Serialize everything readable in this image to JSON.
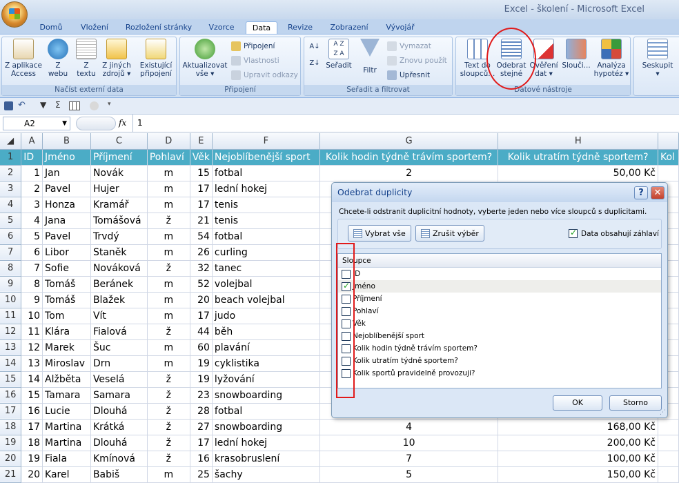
{
  "app": {
    "title": "Excel - školení - Microsoft Excel"
  },
  "tabs": [
    "Domů",
    "Vložení",
    "Rozložení stránky",
    "Vzorce",
    "Data",
    "Revize",
    "Zobrazení",
    "Vývojář"
  ],
  "ribbon": {
    "groups": {
      "external": "Načíst externí data",
      "connections": "Připojení",
      "sort": "Seřadit a filtrovat",
      "tools": "Datové nástroje"
    },
    "buttons": {
      "access": [
        "Z aplikace",
        "Access"
      ],
      "web": [
        "Z",
        "webu"
      ],
      "text": [
        "Z",
        "textu"
      ],
      "other": [
        "Z jiných",
        "zdrojů ▾"
      ],
      "existing": [
        "Existující",
        "připojení"
      ],
      "refresh": [
        "Aktualizovat",
        "vše ▾"
      ],
      "connections": "Připojení",
      "properties": "Vlastnosti",
      "editlinks": "Upravit odkazy",
      "sort": "Seřadit",
      "filter": "Filtr",
      "clear": "Vymazat",
      "reapply": "Znovu použít",
      "advanced": "Upřesnit",
      "text_to_columns": [
        "Text do",
        "sloupců..."
      ],
      "remove_duplicates": [
        "Odebrat",
        "stejné"
      ],
      "validation": [
        "Ověření",
        "dat ▾"
      ],
      "consolidate": [
        "Slouči..."
      ],
      "whatif": [
        "Analýza",
        "hypotéz ▾"
      ],
      "group": [
        "Seskupit",
        "▾"
      ]
    }
  },
  "formula": {
    "namebox": "A2",
    "fx": "fx",
    "value": "1"
  },
  "columns": [
    "A",
    "B",
    "C",
    "D",
    "E",
    "F",
    "G",
    "H"
  ],
  "headers": [
    "ID",
    "Jméno",
    "Příjmení",
    "Pohlaví",
    "Věk",
    "Nejoblíbenější sport",
    "Kolik hodin týdně trávím sportem?",
    "Kolik utratím týdně sportem?",
    "Kol"
  ],
  "rows": [
    [
      "2",
      "1",
      "Jan",
      "Novák",
      "m",
      "15",
      "fotbal",
      "2",
      "50,00 Kč"
    ],
    [
      "3",
      "2",
      "Pavel",
      "Hujer",
      "m",
      "17",
      "lední hokej",
      "",
      ""
    ],
    [
      "4",
      "3",
      "Honza",
      "Kramář",
      "m",
      "17",
      "tenis",
      "",
      ""
    ],
    [
      "5",
      "4",
      "Jana",
      "Tomášová",
      "ž",
      "21",
      "tenis",
      "",
      ""
    ],
    [
      "6",
      "5",
      "Pavel",
      "Trvdý",
      "m",
      "54",
      "fotbal",
      "",
      ""
    ],
    [
      "7",
      "6",
      "Libor",
      "Staněk",
      "m",
      "26",
      "curling",
      "",
      ""
    ],
    [
      "8",
      "7",
      "Sofie",
      "Nováková",
      "ž",
      "32",
      "tanec",
      "",
      ""
    ],
    [
      "9",
      "8",
      "Tomáš",
      "Beránek",
      "m",
      "52",
      "volejbal",
      "",
      ""
    ],
    [
      "10",
      "9",
      "Tomáš",
      "Blažek",
      "m",
      "20",
      "beach volejbal",
      "",
      ""
    ],
    [
      "11",
      "10",
      "Tom",
      "Vít",
      "m",
      "17",
      "judo",
      "",
      ""
    ],
    [
      "12",
      "11",
      "Klára",
      "Fialová",
      "ž",
      "44",
      "běh",
      "",
      ""
    ],
    [
      "13",
      "12",
      "Marek",
      "Šuc",
      "m",
      "60",
      "plavání",
      "",
      ""
    ],
    [
      "14",
      "13",
      "Miroslav",
      "Drn",
      "m",
      "19",
      "cyklistika",
      "",
      ""
    ],
    [
      "15",
      "14",
      "Alžběta",
      "Veselá",
      "ž",
      "19",
      "lyžování",
      "",
      ""
    ],
    [
      "16",
      "15",
      "Tamara",
      "Samara",
      "ž",
      "23",
      "snowboarding",
      "",
      ""
    ],
    [
      "17",
      "16",
      "Lucie",
      "Dlouhá",
      "ž",
      "28",
      "fotbal",
      "",
      ""
    ],
    [
      "18",
      "17",
      "Martina",
      "Krátká",
      "ž",
      "27",
      "snowboarding",
      "4",
      "168,00 Kč"
    ],
    [
      "19",
      "18",
      "Martina",
      "Dlouhá",
      "ž",
      "17",
      "lední hokej",
      "10",
      "200,00 Kč"
    ],
    [
      "20",
      "19",
      "Fiala",
      "Kmínová",
      "ž",
      "16",
      "krasobruslení",
      "7",
      "100,00 Kč"
    ],
    [
      "21",
      "20",
      "Karel",
      "Babiš",
      "m",
      "25",
      "šachy",
      "5",
      "150,00 Kč"
    ]
  ],
  "dialog": {
    "title": "Odebrat duplicity",
    "message": "Chcete-li odstranit duplicitní hodnoty, vyberte jeden nebo více sloupců s duplicitami.",
    "select_all": "Vybrat vše",
    "unselect_all": "Zrušit výběr",
    "has_headers": "Data obsahují záhlaví",
    "has_headers_checked": true,
    "list_header": "Sloupce",
    "items": [
      {
        "label": "ID",
        "checked": false
      },
      {
        "label": "Jméno",
        "checked": true
      },
      {
        "label": "Příjmení",
        "checked": false
      },
      {
        "label": "Pohlaví",
        "checked": false
      },
      {
        "label": "Věk",
        "checked": false
      },
      {
        "label": "Nejoblíbenější sport",
        "checked": false
      },
      {
        "label": "Kolik hodin týdně trávím sportem?",
        "checked": false
      },
      {
        "label": "Kolik utratím týdně sportem?",
        "checked": false
      },
      {
        "label": "Kolik sportů pravidelně provozuji?",
        "checked": false
      }
    ],
    "ok": "OK",
    "cancel": "Storno"
  },
  "colors": {
    "header_fill": "#4bacc6",
    "annotation": "#e11a1a"
  }
}
